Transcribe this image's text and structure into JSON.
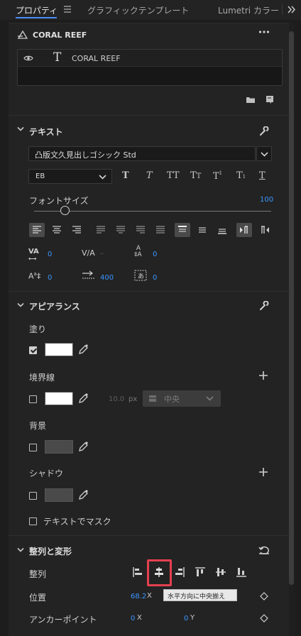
{
  "tabs": [
    {
      "label": "プロパティ"
    },
    {
      "label": "グラフィックテンプレート"
    },
    {
      "label": "Lumetri カラー"
    }
  ],
  "header": {
    "title": "CORAL REEF"
  },
  "layer": {
    "name": "CORAL REEF"
  },
  "text_section": {
    "title": "テキスト",
    "font_family": "凸版文久見出しゴシック Std",
    "font_style": "EB",
    "font_size_label": "フォントサイズ",
    "font_size_value": "100",
    "font_size_fraction": 0.13,
    "kerning": "0",
    "tracking": "–",
    "leading": "0",
    "baseline": "0",
    "tab_width": "400",
    "tsume": "0"
  },
  "appearance_section": {
    "title": "アピアランス",
    "fill": {
      "label": "塗り",
      "checked": true,
      "color": "#ffffff"
    },
    "stroke": {
      "label": "境界線",
      "checked": false,
      "color": "#ffffff",
      "width": "10.0",
      "unit": "px",
      "position": "中央"
    },
    "background": {
      "label": "背景",
      "checked": false,
      "color": "#4a4a4a"
    },
    "shadow": {
      "label": "シャドウ",
      "checked": false,
      "color": "#4a4a4a"
    },
    "mask": {
      "label": "テキストでマスク",
      "checked": false
    }
  },
  "align_section": {
    "title": "整列と変形",
    "align_label": "整列",
    "tooltip": "水平方向に中央揃え",
    "position_label": "位置",
    "position_x": "68.2",
    "x_label": "X",
    "anchor_label": "アンカーポイント",
    "anchor_x": "0",
    "anchor_y": "0",
    "y_label": "Y"
  },
  "colors": {
    "accent": "#3a96ff",
    "highlight": "#e4404f"
  }
}
